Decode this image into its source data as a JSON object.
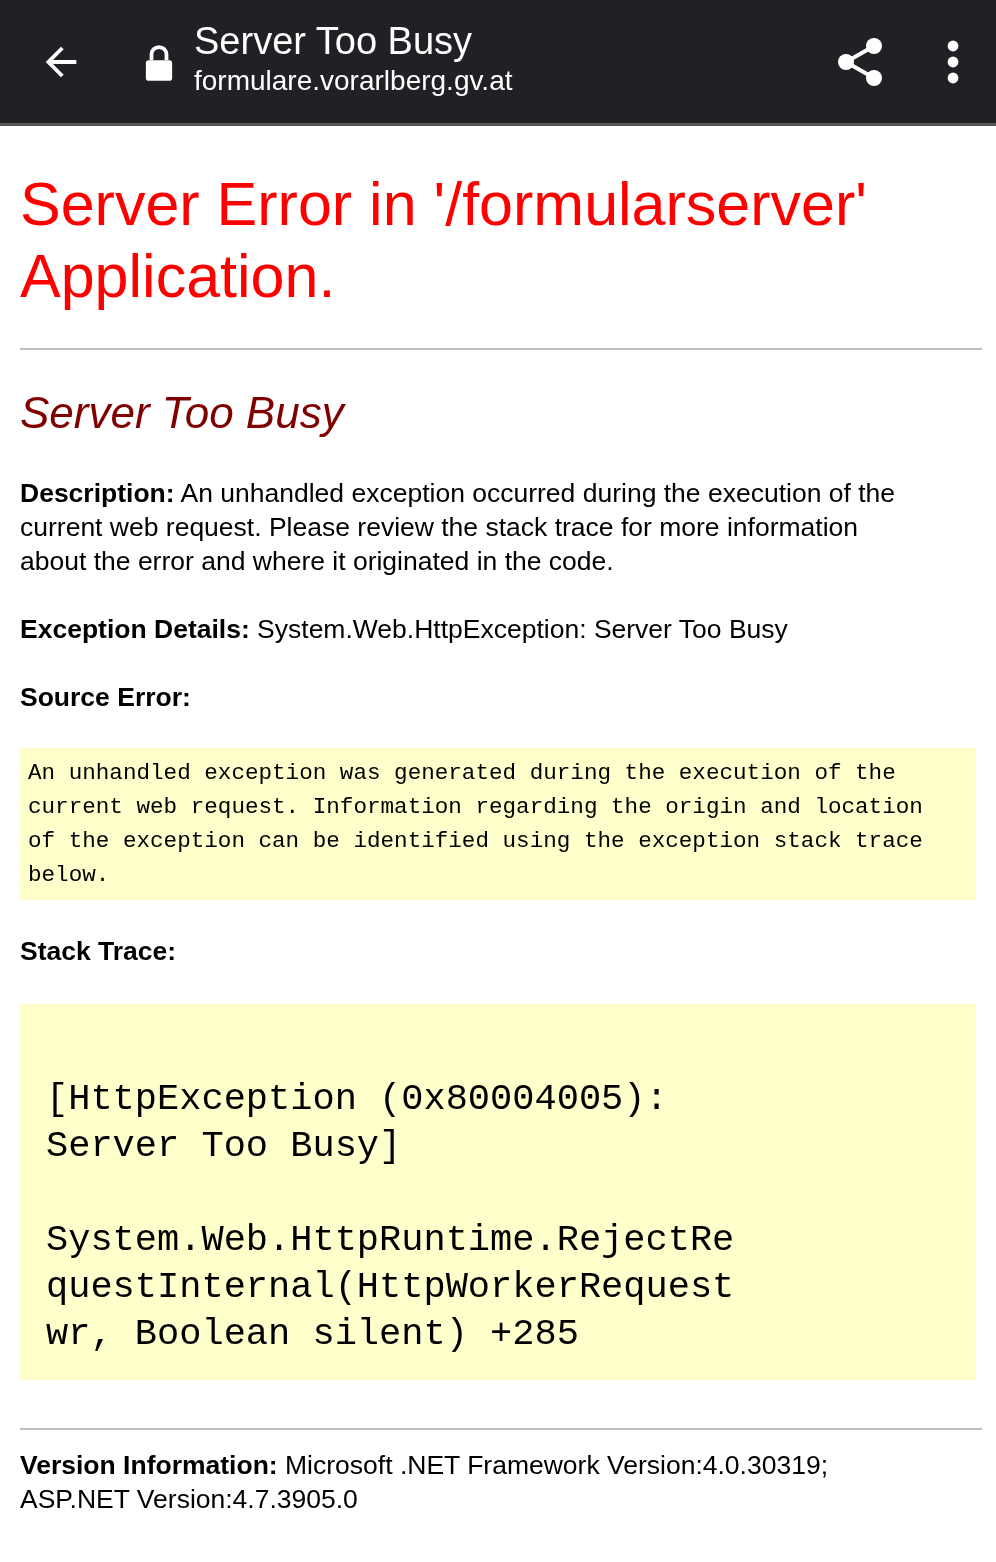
{
  "toolbar": {
    "title": "Server Too Busy",
    "url": "formulare.vorarlberg.gv.at"
  },
  "page": {
    "heading": "Server Error in '/formularserver' Application.",
    "subheading": "Server Too Busy",
    "description": "**Description:** An unhandled exception occurred during the execution of the current web request. Please review the stack trace for more information about the error and where it originated in the code.",
    "exception_details": "**Exception Details:** System.Web.HttpException: Server Too Busy",
    "source_error_label": "Source Error:",
    "source_error": "An unhandled exception was generated during the execution of the current web request. Information regarding the origin and location of the exception can be identified using the exception stack trace below.",
    "stack_trace_label": "Stack Trace:",
    "stack_trace": [
      [
        "[HttpException (0x80004005):",
        "Server Too Busy]"
      ],
      [
        "System.Web.HttpRuntime.RejectRe",
        "questInternal(HttpWorkerRequest",
        "wr, Boolean silent) +285"
      ]
    ],
    "version_info": "**Version Information:** Microsoft .NET Framework Version:4.0.30319; ASP.NET Version:4.7.3905.0"
  }
}
